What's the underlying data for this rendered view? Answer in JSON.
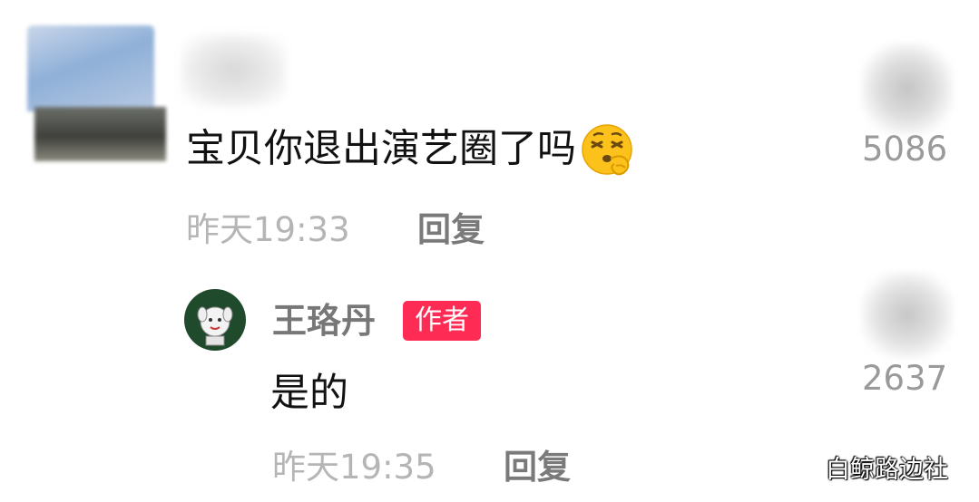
{
  "comment": {
    "text": "宝贝你退出演艺圈了吗",
    "emoji": "shushing-face-emoji",
    "time": "昨天19:33",
    "reply_label": "回复",
    "likes": "5086"
  },
  "reply": {
    "author_name": "王珞丹",
    "author_badge": "作者",
    "text": "是的",
    "time": "昨天19:35",
    "reply_label": "回复",
    "likes": "2637"
  },
  "watermark": "白鲸路边社",
  "colors": {
    "badge": "#fe2c55",
    "time": "#b5b5b5",
    "author_name": "#777777"
  }
}
